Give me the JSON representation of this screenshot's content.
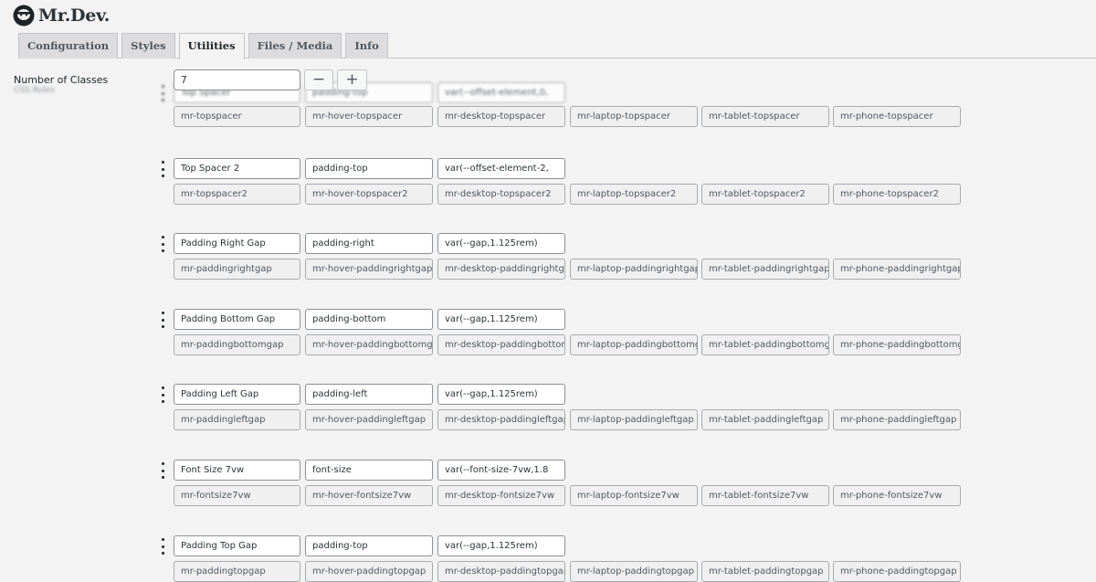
{
  "app": {
    "brand": "Mr.Dev.",
    "logo_icon": "bearded-face-icon"
  },
  "tabs": [
    {
      "label": "Configuration",
      "active": false
    },
    {
      "label": "Styles",
      "active": false
    },
    {
      "label": "Utilities",
      "active": true
    },
    {
      "label": "Files / Media",
      "active": false
    },
    {
      "label": "Info",
      "active": false
    }
  ],
  "number_of_classes": {
    "label": "Number of Classes",
    "sublabel": "CSS Rules",
    "value": "7",
    "decrement_label": "−",
    "increment_label": "+"
  },
  "rows": [
    {
      "name": "Top Spacer",
      "property": "padding-top",
      "value": "var(--offset-element,0,",
      "classes": [
        "mr-topspacer",
        "mr-hover-topspacer",
        "mr-desktop-topspacer",
        "mr-laptop-topspacer",
        "mr-tablet-topspacer",
        "mr-phone-topspacer"
      ]
    },
    {
      "name": "Top Spacer 2",
      "property": "padding-top",
      "value": "var(--offset-element-2,",
      "classes": [
        "mr-topspacer2",
        "mr-hover-topspacer2",
        "mr-desktop-topspacer2",
        "mr-laptop-topspacer2",
        "mr-tablet-topspacer2",
        "mr-phone-topspacer2"
      ]
    },
    {
      "name": "Padding Right Gap",
      "property": "padding-right",
      "value": "var(--gap,1.125rem)",
      "classes": [
        "mr-paddingrightgap",
        "mr-hover-paddingrightgap",
        "mr-desktop-paddingrightgap",
        "mr-laptop-paddingrightgap",
        "mr-tablet-paddingrightgap",
        "mr-phone-paddingrightgap"
      ]
    },
    {
      "name": "Padding Bottom Gap",
      "property": "padding-bottom",
      "value": "var(--gap,1.125rem)",
      "classes": [
        "mr-paddingbottomgap",
        "mr-hover-paddingbottomgap",
        "mr-desktop-paddingbottomgap",
        "mr-laptop-paddingbottomgap",
        "mr-tablet-paddingbottomgap",
        "mr-phone-paddingbottomgap"
      ]
    },
    {
      "name": "Padding Left Gap",
      "property": "padding-left",
      "value": "var(--gap,1.125rem)",
      "classes": [
        "mr-paddingleftgap",
        "mr-hover-paddingleftgap",
        "mr-desktop-paddingleftgap",
        "mr-laptop-paddingleftgap",
        "mr-tablet-paddingleftgap",
        "mr-phone-paddingleftgap"
      ]
    },
    {
      "name": "Font Size 7vw",
      "property": "font-size",
      "value": "var(--font-size-7vw,1.8",
      "classes": [
        "mr-fontsize7vw",
        "mr-hover-fontsize7vw",
        "mr-desktop-fontsize7vw",
        "mr-laptop-fontsize7vw",
        "mr-tablet-fontsize7vw",
        "mr-phone-fontsize7vw"
      ]
    },
    {
      "name": "Padding Top Gap",
      "property": "padding-top",
      "value": "var(--gap,1.125rem)",
      "classes": [
        "mr-paddingtopgap",
        "mr-hover-paddingtopgap",
        "mr-desktop-paddingtopgap",
        "mr-laptop-paddingtopgap",
        "mr-tablet-paddingtopgap",
        "mr-phone-paddingtopgap"
      ]
    }
  ]
}
